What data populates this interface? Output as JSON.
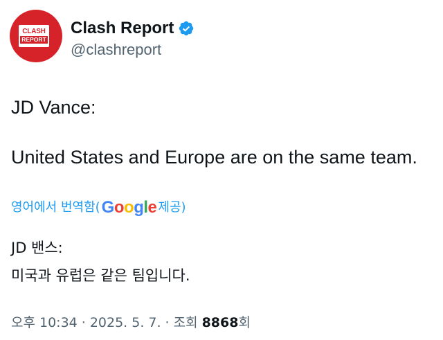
{
  "colors": {
    "brand_red": "#d6232a",
    "verified_blue": "#1d9bf0",
    "link_blue": "#1d9bf0",
    "muted_gray": "#536471",
    "text_dark": "#0f1419"
  },
  "author": {
    "avatar_top": "CLASH",
    "avatar_bottom": "REPORT",
    "display_name": "Clash Report",
    "handle": "@clashreport",
    "verified_icon": "verified-badge-icon"
  },
  "tweet": {
    "line1": "JD Vance:",
    "line2": "United States and Europe are on the same team."
  },
  "translate": {
    "prefix": "영어에서 번역함(",
    "google": [
      "G",
      "o",
      "o",
      "g",
      "l",
      "e"
    ],
    "suffix": " 제공)"
  },
  "translation": {
    "line1": "JD 밴스:",
    "line2": "미국과 유럽은 같은 팀입니다."
  },
  "meta": {
    "time": "오후 10:34",
    "sep1": "·",
    "date": "2025. 5. 7.",
    "sep2": "·",
    "views_label": "조회",
    "views_count": "8868",
    "views_suffix": "회"
  }
}
